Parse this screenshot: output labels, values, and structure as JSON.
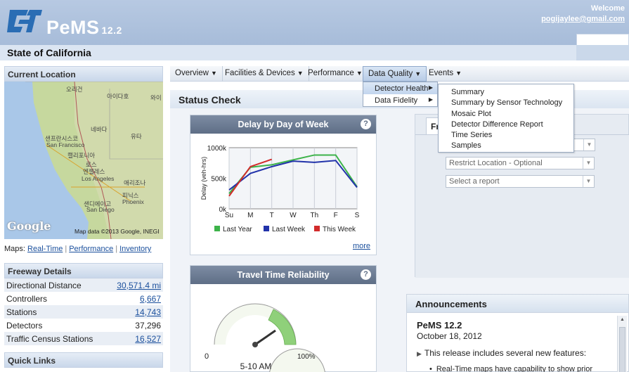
{
  "header": {
    "brand": "PeMS",
    "version": "12.2",
    "welcome": "Welcome",
    "email": "pogijaylee@gmail.com",
    "state": "State of California"
  },
  "left": {
    "current_location_title": "Current Location",
    "map": {
      "labels": [
        "오리건",
        "아이다호",
        "와이",
        "네바다",
        "유타",
        "샌프란시스코",
        "San Francisco",
        "캘리포니아",
        "로스",
        "엔젤레스",
        "Los Angeles",
        "애리조나",
        "피닉스",
        "Phoenix",
        "샌디에이고",
        "San Diego"
      ],
      "google": "Google",
      "map_data": "Map data ©2013 Google, INEGI"
    },
    "maps_prefix": "Maps:",
    "maps_links": [
      "Real-Time",
      "Performance",
      "Inventory"
    ],
    "freeway_title": "Freeway Details",
    "freeway_rows": [
      {
        "label": "Directional Distance",
        "value": "30,571.4 mi",
        "link": true
      },
      {
        "label": "Controllers",
        "value": "6,667",
        "link": true
      },
      {
        "label": "Stations",
        "value": "14,743",
        "link": true
      },
      {
        "label": "Detectors",
        "value": "37,296",
        "link": false
      },
      {
        "label": "Traffic Census Stations",
        "value": "16,527",
        "link": true
      }
    ],
    "quick_links_title": "Quick Links"
  },
  "menu": {
    "items": [
      "Overview",
      "Facilities & Devices",
      "Performance",
      "Data Quality",
      "Events"
    ],
    "active": "Data Quality",
    "submenu": [
      "Detector Health",
      "Data Fidelity"
    ],
    "submenu_active": "Detector Health",
    "submenu2": [
      "Summary",
      "Summary by Sensor Technology",
      "Mosaic Plot",
      "Detector Difference Report",
      "Time Series",
      "Samples"
    ]
  },
  "status": {
    "title": "Status Check",
    "delay_widget": {
      "title": "Delay by Day of Week",
      "more": "more"
    },
    "travel_widget": {
      "title": "Travel Time Reliability",
      "gauge_min": "0",
      "gauge_max": "100%",
      "time_label": "5-10 AM"
    }
  },
  "right": {
    "tab_label": "Fre",
    "restrict_placeholder": "Restrict Location - Optional",
    "report_placeholder": "Select a report",
    "announcements_title": "Announcements",
    "ann_heading": "PeMS 12.2",
    "ann_date": "October 18, 2012",
    "ann_feature": "This release includes several new features:",
    "ann_bullet": "Real-Time maps have capability to show prior"
  },
  "chart_data": {
    "type": "line",
    "categories": [
      "Su",
      "M",
      "T",
      "W",
      "Th",
      "F",
      "S"
    ],
    "ylabel": "Delay (veh-hrs)",
    "yticks": [
      "0k",
      "500k",
      "1000k"
    ],
    "ylim": [
      0,
      1000
    ],
    "grid": true,
    "legend_placement": "bottom",
    "series": [
      {
        "name": "Last Year",
        "color": "#3db34a",
        "values": [
          250,
          680,
          720,
          800,
          880,
          880,
          360
        ]
      },
      {
        "name": "Last Week",
        "color": "#2233aa",
        "values": [
          310,
          580,
          690,
          780,
          760,
          790,
          350
        ]
      },
      {
        "name": "This Week",
        "color": "#d22b2b",
        "values": [
          210,
          690,
          810,
          null,
          null,
          null,
          null
        ]
      }
    ]
  }
}
